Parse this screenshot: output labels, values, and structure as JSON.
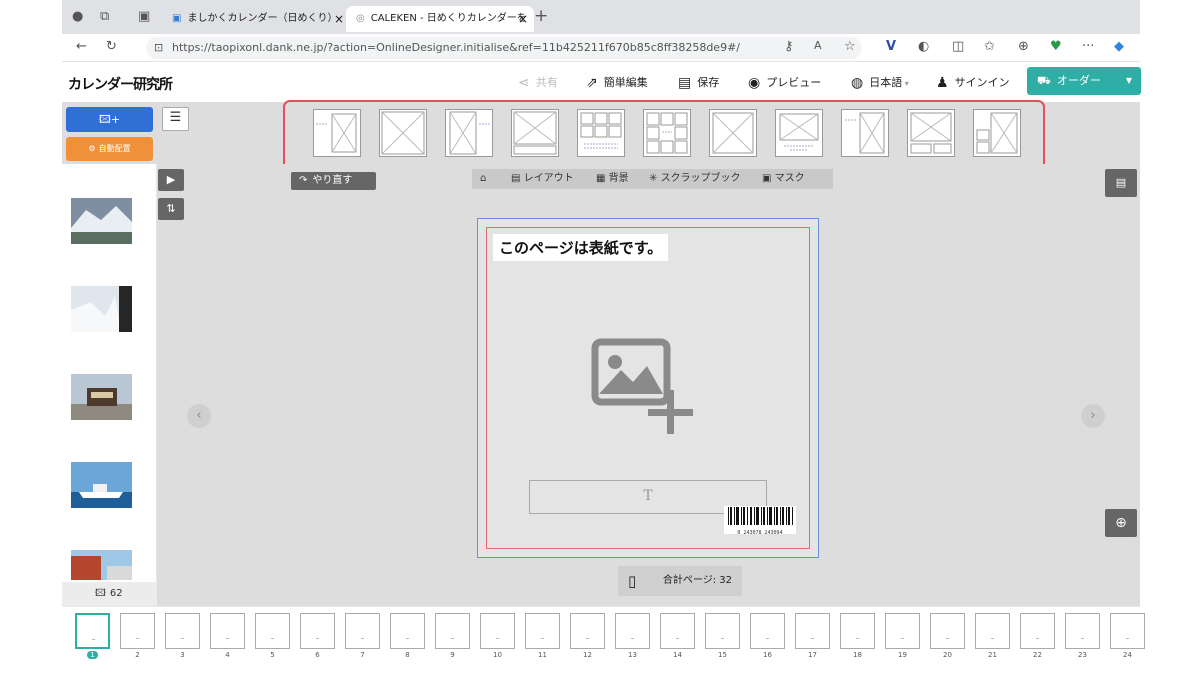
{
  "browser": {
    "tabs": [
      {
        "label": "ましかくカレンダー（日めくり）-",
        "active": false
      },
      {
        "label": "CALEKEN - 日めくりカレンダーを",
        "active": true
      }
    ],
    "new_tab": "+",
    "close": "×",
    "url_host": "https://taopixonl.dank.ne.jp",
    "url_path": "/?action=OnlineDesigner.initialise&ref=11b425211f670b85c8ff38258de9#/",
    "more": "···"
  },
  "app": {
    "logo": "カレンダー研究所",
    "menu": {
      "share": "共有",
      "quick_edit": "簡単編集",
      "save": "保存",
      "preview": "プレビュー",
      "language": "日本語",
      "signin": "サインイン",
      "order": "オーダー"
    }
  },
  "toolbar": {
    "auto_place": "自動配置",
    "layout_count": 11
  },
  "canvas": {
    "redo": "やり直す",
    "tabs": [
      "レイアウト",
      "背景",
      "スクラップブック",
      "マスク"
    ],
    "cover_label": "このページは表紙です。",
    "text_placeholder": "T",
    "barcode_number": "0 243078 243094",
    "total_pages_label": "合計ページ: 32"
  },
  "sidebar": {
    "photo_count": "62"
  },
  "filmstrip": {
    "pages": [
      "1",
      "2",
      "3",
      "4",
      "5",
      "6",
      "7",
      "8",
      "9",
      "10",
      "11",
      "12",
      "13",
      "14",
      "15",
      "16",
      "17",
      "18",
      "19",
      "20",
      "21",
      "22",
      "23",
      "24"
    ],
    "selected": "1"
  },
  "colors": {
    "accent": "#2eaea5",
    "primary_button": "#2f6fd6",
    "auto_button": "#f0913a",
    "highlight": "#e4505c"
  }
}
